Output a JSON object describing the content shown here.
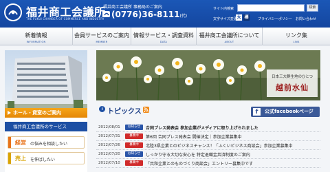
{
  "header": {
    "title": "福井商工会議所",
    "title_en": "THE FUKUI CHAMBER OF COMMERCE AND INDUSTRY",
    "office_label": "福井商工会議所 事務局のご案内",
    "phone": "(0776)36-8111",
    "phone_suffix": "(代)",
    "search_label": "サイト内検索",
    "search_placeholder": "",
    "search_button": "検索",
    "font_size_label": "文字サイズ変更",
    "font_large": "大",
    "font_standard": "標",
    "privacy_link": "プライバシーポリシー",
    "contact_link": "お問い合わせ"
  },
  "nav": [
    {
      "ja": "新着情報",
      "en": "INFORMATION"
    },
    {
      "ja": "会員サービスのご案内",
      "en": "MEMBER"
    },
    {
      "ja": "情報サービス・調査資料",
      "en": "DATA"
    },
    {
      "ja": "福井商工会議所について",
      "en": "ABOUT"
    },
    {
      "ja": "リンク集",
      "en": "LINK"
    }
  ],
  "sidebar": {
    "hall_banner": "ホール・貸室のご案内",
    "services_heading": "福井商工会議所のサービス",
    "services": [
      {
        "strong": "経営",
        "rest": "の悩みを相談したい",
        "color": "#e8731a"
      },
      {
        "strong": "売上",
        "rest": "を伸ばしたい",
        "color": "#d9a400"
      }
    ]
  },
  "hero": {
    "subtitle": "日本三大群生地のひとつ",
    "title": "越前水仙"
  },
  "topics": {
    "title": "トピックス",
    "facebook_label": "公式facebookページ"
  },
  "news": [
    {
      "date": "2012/08/01",
      "badge": "お知らせ",
      "badge_color": "#2a55a8",
      "title": "合同プレス発表会 参加企業がメディアに取り上げられました",
      "bold": true
    },
    {
      "date": "2012/07/31",
      "badge": "募集中",
      "badge_color": "#d02b2b",
      "title": "第6回 合同プレス発表会 開催決定｜参加企業募集中",
      "bold": false
    },
    {
      "date": "2012/07/26",
      "badge": "募集中",
      "badge_color": "#d02b2b",
      "title": "北陸3県企業とのビジネスチャンス！「ふくいビジネス商談会」参加企業募集中",
      "bold": false
    },
    {
      "date": "2012/07/20",
      "badge": "お知らせ",
      "badge_color": "#2a55a8",
      "title": "しっかり守る大切な安心を 特定退職金共済制度のご案内",
      "bold": false
    },
    {
      "date": "2012/07/10",
      "badge": "募集中",
      "badge_color": "#d02b2b",
      "title": "「共和企業とのものづくり商談会」エントリー募集中です",
      "bold": false
    }
  ]
}
